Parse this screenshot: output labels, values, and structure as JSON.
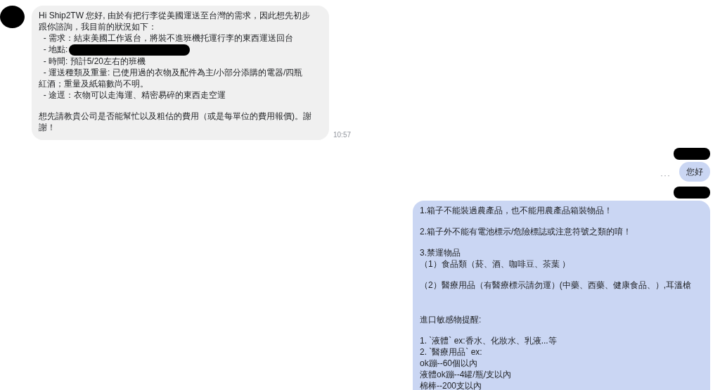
{
  "messages": [
    {
      "kind": "incoming",
      "time": "10:57",
      "paragraphs": [
        {
          "lines": [
            {
              "text": "Hi Ship2TW 您好, 由於有把行李從美國運送至台灣的需求，因此想先初步"
            },
            {
              "text": "跟你諮詢，我目前的狀況如下："
            },
            {
              "text": "  - 需求：結束美國工作返台，將裝不進班機托運行李的東西運送回台"
            },
            {
              "text": "  - 地點:",
              "redacted": true
            },
            {
              "text": "  - 時間: 預計5/20左右的班機"
            },
            {
              "text": "  - 運送種類及重量: 已使用過的衣物及配件為主/小部分添購的電器/四瓶"
            },
            {
              "text": "紅酒；重量及紙箱數尚不明。"
            },
            {
              "text": "  - 途逕：衣物可以走海運、精密易碎的東西走空運"
            }
          ]
        },
        {
          "lines": [
            {
              "text": "想先請教貴公司是否能幫忙以及粗估的費用（或是每單位的費用報價)。謝"
            },
            {
              "text": "謝！"
            }
          ]
        }
      ]
    },
    {
      "kind": "outgoing",
      "status": "···",
      "paragraphs": [
        {
          "lines": [
            {
              "text": "您好"
            }
          ]
        }
      ]
    },
    {
      "kind": "outgoing",
      "paragraphs": [
        {
          "lines": [
            {
              "text": "1.箱子不能裝過農產品，也不能用農產品箱裝物品！"
            }
          ]
        },
        {
          "lines": [
            {
              "text": "2.箱子外不能有電池標示/危險標誌或注意符號之類的唷！"
            }
          ]
        },
        {
          "lines": [
            {
              "text": "3.禁運物品"
            },
            {
              "text": "（1）食品類（菸、酒、咖啡豆、茶葉 ）"
            }
          ]
        },
        {
          "lines": [
            {
              "text": "（2）醫療用品（有醫療標示請勿運）(中藥、西藥、健康食品、）,耳溫槍"
            }
          ]
        },
        {
          "kind": "section",
          "lines": [
            {
              "text": "進口敏感物提醒:"
            }
          ]
        },
        {
          "lines": [
            {
              "text": "1. `液體` ex:香水、化妝水、乳液...等"
            },
            {
              "text": "2. `醫療用品` ex:"
            },
            {
              "text": "ok蹦--60個以內"
            },
            {
              "text": "液體ok蹦--4罐/瓶/支以內"
            },
            {
              "text": "棉棒--200支以內"
            }
          ]
        }
      ]
    }
  ]
}
